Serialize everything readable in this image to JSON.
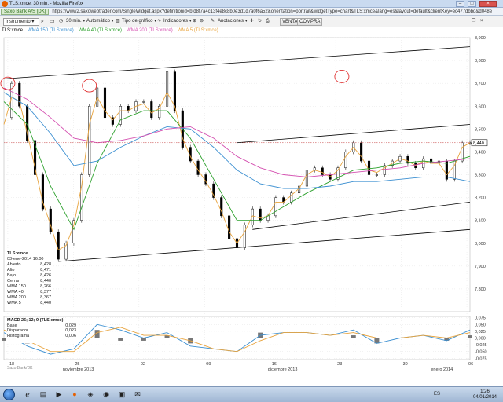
{
  "window": {
    "title": "TLS:xmce, 30 min. - Mozilla Firefox",
    "minimize": "–",
    "maximize": "□",
    "close": "×"
  },
  "address": {
    "site_badge": "Saxo Bank A/S [DK]",
    "url": "https://www2.saxowebtrader.com/SingleWidget.aspx?definitionid=bfd8f7a4c13f4e8c8b0e3d1d7a0f6a52&orientation=portrait&widgetType=chart&TLS:xmce&lang=es&layout=default&clientKey=ec477dbbd&d048e48a845604d3defe8e1"
  },
  "toolbar": {
    "instrument_label": "Instrumento",
    "timeframe": "30 min.",
    "autoscale": "Automático",
    "chart_type": "Tipo de gráfico",
    "indicators": "Indicadores",
    "annotations": "Anotaciones",
    "sell_button": "VENTA",
    "buy_button": "COMPRA"
  },
  "legend": {
    "instrument": "TLS:xmce",
    "wma150": "WMA 150 (TLS:xmce)",
    "wma40": "WMA 40 (TLS:xmce)",
    "wma200": "WMA 200 (TLS:xmce)",
    "wma5": "WMA 5 (TLS:xmce)"
  },
  "info_box": {
    "symbol": "TLS:xmce",
    "datetime": "03-ene-2014 16:00",
    "rows": [
      {
        "label": "Abierto",
        "value": "8,428"
      },
      {
        "label": "Alto",
        "value": "8,471"
      },
      {
        "label": "Bajo",
        "value": "8,426"
      },
      {
        "label": "Cerrar",
        "value": "8,440"
      },
      {
        "label": "WMA 150",
        "value": "8,266"
      },
      {
        "label": "WMA 40",
        "value": "8,377"
      },
      {
        "label": "WMA 200",
        "value": "8,367"
      },
      {
        "label": "WMA 5",
        "value": "8,440"
      }
    ]
  },
  "macd_box": {
    "title": "MACD 26; 12; 9 (TLS:xmce)",
    "rows": [
      {
        "label": "Base",
        "value": "0,029"
      },
      {
        "label": "Disparador",
        "value": "0,023"
      },
      {
        "label": "Histograma",
        "value": "0,006"
      }
    ]
  },
  "price_tag": "8,440",
  "footer_note": "Saxo Bank/DK",
  "taskbar": {
    "language": "ES",
    "time": "1:26",
    "date": "04/01/2014"
  },
  "colors": {
    "price": "#000000",
    "wma5": "#e8a33c",
    "wma40": "#2ca02c",
    "wma150": "#3b8fd1",
    "wma200": "#d44fb0",
    "trendline": "#000000",
    "highlight_circle": "#e03030",
    "macd_base": "#3b8fd1",
    "macd_signal": "#e8a33c"
  },
  "chart_data": [
    {
      "type": "line",
      "panel": "price",
      "ylim": [
        7.7,
        8.9
      ],
      "y_ticks": [
        "8,900",
        "8,800",
        "8,700",
        "8,600",
        "8,500",
        "8,400",
        "8,300",
        "8,200",
        "8,100",
        "8,000",
        "7,900",
        "7,800"
      ],
      "x_ticks": [
        "18",
        "25",
        "02",
        "09",
        "16",
        "23",
        "30",
        "06"
      ],
      "x_month_labels": [
        "noviembre 2013",
        "diciembre 2013",
        "enero 2014"
      ],
      "x_range": [
        0,
        120
      ],
      "last_price": 8.44,
      "series": [
        {
          "name": "TLS:xmce",
          "key": "price",
          "x": [
            0,
            2,
            4,
            6,
            8,
            10,
            12,
            14,
            16,
            18,
            20,
            22,
            24,
            26,
            28,
            30,
            32,
            34,
            36,
            38,
            40,
            42,
            44,
            46,
            48,
            50,
            52,
            54,
            56,
            58,
            60,
            62,
            64,
            66,
            68,
            70,
            72,
            74,
            76,
            78,
            80,
            82,
            84,
            86,
            88,
            90,
            92,
            94,
            96,
            98,
            100,
            102,
            104,
            106,
            108,
            110,
            112,
            114,
            116,
            118,
            120
          ],
          "y": [
            8.55,
            8.7,
            8.6,
            8.45,
            8.3,
            8.15,
            8.05,
            7.93,
            8.0,
            8.1,
            8.3,
            8.6,
            8.68,
            8.55,
            8.52,
            8.6,
            8.58,
            8.62,
            8.62,
            8.55,
            8.6,
            8.75,
            8.58,
            8.42,
            8.36,
            8.3,
            8.26,
            8.2,
            8.12,
            8.02,
            7.98,
            8.08,
            8.15,
            8.1,
            8.12,
            8.2,
            8.18,
            8.22,
            8.25,
            8.32,
            8.33,
            8.3,
            8.28,
            8.33,
            8.4,
            8.44,
            8.36,
            8.3,
            8.3,
            8.34,
            8.36,
            8.38,
            8.35,
            8.33,
            8.37,
            8.35,
            8.36,
            8.28,
            8.36,
            8.44,
            8.44
          ]
        },
        {
          "name": "WMA 5",
          "key": "wma5",
          "x": [
            0,
            2,
            4,
            6,
            8,
            10,
            12,
            14,
            16,
            18,
            20,
            22,
            24,
            26,
            28,
            30,
            32,
            34,
            36,
            38,
            40,
            42,
            44,
            46,
            48,
            50,
            52,
            54,
            56,
            58,
            60,
            62,
            64,
            66,
            68,
            70,
            72,
            74,
            76,
            78,
            80,
            82,
            84,
            86,
            88,
            90,
            92,
            94,
            96,
            98,
            100,
            102,
            104,
            106,
            108,
            110,
            112,
            114,
            116,
            118,
            120
          ],
          "y": [
            8.52,
            8.64,
            8.62,
            8.48,
            8.33,
            8.18,
            8.08,
            7.97,
            7.99,
            8.08,
            8.25,
            8.52,
            8.64,
            8.58,
            8.54,
            8.58,
            8.58,
            8.6,
            8.61,
            8.57,
            8.59,
            8.66,
            8.6,
            8.46,
            8.38,
            8.32,
            8.27,
            8.21,
            8.14,
            8.05,
            8.0,
            8.05,
            8.12,
            8.11,
            8.12,
            8.18,
            8.18,
            8.21,
            8.24,
            8.3,
            8.32,
            8.31,
            8.29,
            8.32,
            8.38,
            8.42,
            8.38,
            8.32,
            8.31,
            8.33,
            8.35,
            8.37,
            8.36,
            8.34,
            8.36,
            8.35,
            8.35,
            8.3,
            8.34,
            8.42,
            8.44
          ]
        },
        {
          "name": "WMA 40",
          "key": "wma40",
          "x": [
            0,
            6,
            12,
            18,
            24,
            30,
            36,
            42,
            48,
            54,
            60,
            66,
            72,
            78,
            84,
            90,
            96,
            102,
            108,
            114,
            120
          ],
          "y": [
            8.62,
            8.52,
            8.25,
            8.06,
            8.35,
            8.54,
            8.58,
            8.58,
            8.46,
            8.28,
            8.1,
            8.1,
            8.16,
            8.22,
            8.27,
            8.32,
            8.33,
            8.35,
            8.36,
            8.35,
            8.38
          ]
        },
        {
          "name": "WMA 150",
          "key": "wma150",
          "x": [
            0,
            6,
            12,
            18,
            24,
            30,
            36,
            42,
            48,
            54,
            60,
            66,
            72,
            78,
            84,
            90,
            96,
            102,
            108,
            114,
            120
          ],
          "y": [
            8.66,
            8.6,
            8.48,
            8.34,
            8.36,
            8.42,
            8.47,
            8.51,
            8.5,
            8.42,
            8.32,
            8.26,
            8.24,
            8.24,
            8.25,
            8.27,
            8.27,
            8.28,
            8.29,
            8.29,
            8.27
          ]
        },
        {
          "name": "WMA 200",
          "key": "wma200",
          "x": [
            0,
            6,
            12,
            18,
            24,
            30,
            36,
            42,
            48,
            54,
            60,
            66,
            72,
            78,
            84,
            90,
            96,
            102,
            108,
            114,
            120
          ],
          "y": [
            8.68,
            8.63,
            8.55,
            8.46,
            8.44,
            8.45,
            8.47,
            8.5,
            8.51,
            8.46,
            8.38,
            8.33,
            8.3,
            8.29,
            8.3,
            8.31,
            8.32,
            8.33,
            8.35,
            8.36,
            8.37
          ]
        }
      ],
      "trendlines": [
        {
          "x": [
            0,
            120
          ],
          "y": [
            8.72,
            8.86
          ]
        },
        {
          "x": [
            14,
            120
          ],
          "y": [
            7.92,
            8.06
          ]
        },
        {
          "x": [
            60,
            120
          ],
          "y": [
            8.44,
            8.52
          ]
        },
        {
          "x": [
            64,
            120
          ],
          "y": [
            8.06,
            8.18
          ]
        }
      ],
      "highlight_points": [
        {
          "x": 1,
          "y": 8.7
        },
        {
          "x": 22,
          "y": 8.69
        },
        {
          "x": 87,
          "y": 8.73
        }
      ]
    },
    {
      "type": "line",
      "panel": "macd",
      "title": "MACD 26; 12; 9 (TLS:xmce)",
      "ylim": [
        -0.08,
        0.08
      ],
      "y_ticks": [
        "0,075",
        "0,050",
        "0,025",
        "0,000",
        "-0,025",
        "-0,050",
        "-0,075"
      ],
      "series": [
        {
          "name": "Base",
          "key": "macd_base",
          "x": [
            0,
            6,
            12,
            18,
            24,
            30,
            36,
            42,
            48,
            54,
            60,
            66,
            72,
            78,
            84,
            90,
            96,
            102,
            108,
            114,
            120
          ],
          "y": [
            0.02,
            -0.03,
            -0.06,
            -0.04,
            0.05,
            0.03,
            0.0,
            0.02,
            -0.03,
            -0.04,
            -0.05,
            0.01,
            0.02,
            0.02,
            0.01,
            0.03,
            -0.02,
            0.0,
            0.01,
            -0.01,
            0.03
          ]
        },
        {
          "name": "Disparador",
          "key": "macd_signal",
          "x": [
            0,
            6,
            12,
            18,
            24,
            30,
            36,
            42,
            48,
            54,
            60,
            66,
            72,
            78,
            84,
            90,
            96,
            102,
            108,
            114,
            120
          ],
          "y": [
            0.03,
            -0.01,
            -0.05,
            -0.05,
            0.02,
            0.04,
            0.01,
            0.01,
            -0.01,
            -0.04,
            -0.05,
            -0.01,
            0.02,
            0.02,
            0.01,
            0.02,
            0.0,
            0.0,
            0.01,
            0.0,
            0.02
          ]
        }
      ]
    }
  ]
}
